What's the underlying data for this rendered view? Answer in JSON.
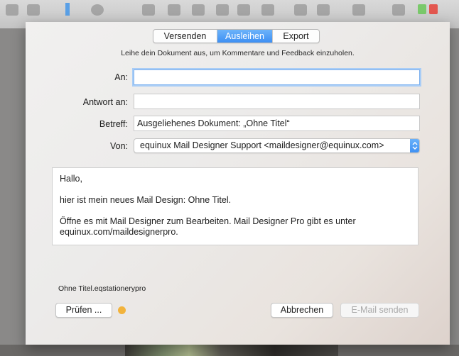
{
  "tabs": [
    {
      "label": "Versenden",
      "active": false
    },
    {
      "label": "Ausleihen",
      "active": true
    },
    {
      "label": "Export",
      "active": false
    }
  ],
  "intro_text": "Leihe dein Dokument aus, um Kommentare und Feedback einzuholen.",
  "form": {
    "to_label": "An:",
    "to_value": "",
    "reply_label": "Antwort an:",
    "reply_value": "",
    "subject_label": "Betreff:",
    "subject_value": "Ausgeliehenes Dokument: „Ohne Titel“",
    "from_label": "Von:",
    "from_value": "equinux Mail Designer Support <maildesigner@equinux.com>"
  },
  "message": {
    "greeting": "Hallo,",
    "line1": "hier ist mein neues Mail Design: Ohne Titel.",
    "line2": "Öffne es mit Mail Designer zum Bearbeiten. Mail Designer Pro gibt es unter equinux.com/maildesignerpro."
  },
  "attachment_name": "Ohne Titel.eqstationerypro",
  "buttons": {
    "check": "Prüfen ...",
    "cancel": "Abbrechen",
    "send": "E-Mail senden"
  },
  "colors": {
    "accent": "#3d8ff3",
    "status_dot": "#f2b33c"
  }
}
